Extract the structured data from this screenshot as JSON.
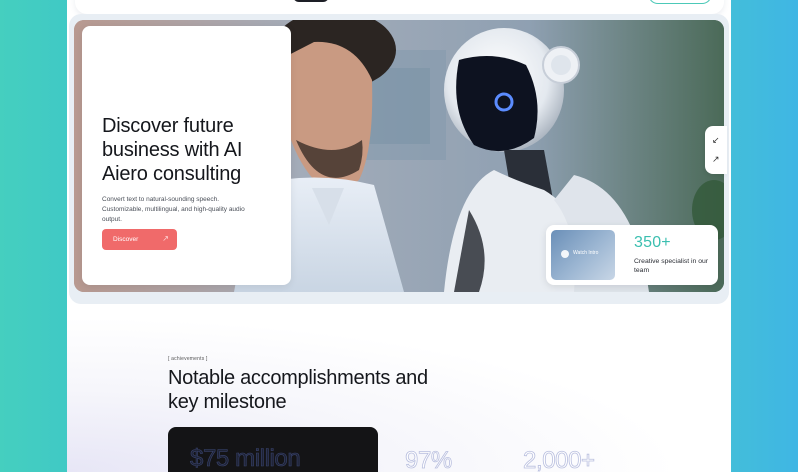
{
  "hero": {
    "title": "Discover future business with AI Aiero consulting",
    "subtitle": "Convert text to natural-sounding speech. Customizable, multilingual, and high-quality audio output.",
    "discover_label": "Discover",
    "discover_arrow": "↗"
  },
  "side_controls": {
    "collapse_icon": "↙",
    "expand_icon": "↗"
  },
  "stat": {
    "number": "350+",
    "text": "Creative specialist in our team",
    "watch_label": "Watch Intro"
  },
  "achievements": {
    "tag": "[ achievements ]",
    "title": "Notable accomplishments and key milestone",
    "value_1": "$75 million",
    "value_2": "97%",
    "value_3": "2,000+"
  },
  "colors": {
    "accent_teal": "#3bbfb0",
    "cta_red": "#f06a6a",
    "background_gradient_start": "#45cfbf",
    "background_gradient_end": "#3fb6e4"
  }
}
